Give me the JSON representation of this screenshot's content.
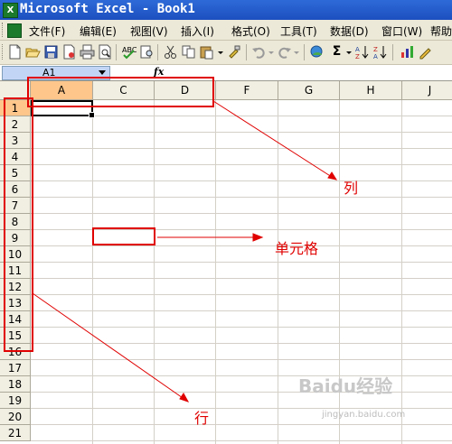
{
  "window": {
    "title": "Microsoft Excel - Book1",
    "app_icon_glyph": "X"
  },
  "menu": {
    "items": [
      "文件(F)",
      "编辑(E)",
      "视图(V)",
      "插入(I)",
      "格式(O)",
      "工具(T)",
      "数据(D)",
      "窗口(W)",
      "帮助"
    ]
  },
  "toolbar": {
    "icons": [
      "new-icon",
      "open-icon",
      "save-icon",
      "permission-icon",
      "print-icon",
      "print-preview-icon",
      "spelling-icon",
      "research-icon",
      "cut-icon",
      "copy-icon",
      "paste-icon",
      "format-painter-icon",
      "undo-icon",
      "redo-icon",
      "hyperlink-icon",
      "autosum-icon",
      "sort-ascending-icon",
      "sort-descending-icon"
    ],
    "autosum_glyph": "Σ"
  },
  "formula_bar": {
    "name_box": "A1",
    "fx_label": "fx",
    "formula": ""
  },
  "sheet": {
    "columns": [
      "A",
      "C",
      "D",
      "F",
      "G",
      "H",
      "J"
    ],
    "rows": [
      "1",
      "2",
      "3",
      "4",
      "5",
      "6",
      "7",
      "8",
      "9",
      "10",
      "11",
      "12",
      "13",
      "14",
      "15",
      "16",
      "17",
      "18",
      "19",
      "20",
      "21"
    ],
    "active_cell": "A1"
  },
  "annotations": {
    "column_label": "列",
    "cell_label": "单元格",
    "row_label": "行",
    "color": "#e00000"
  },
  "watermark": {
    "text": "Baidu经验",
    "url": "jingyan.baidu.com"
  }
}
